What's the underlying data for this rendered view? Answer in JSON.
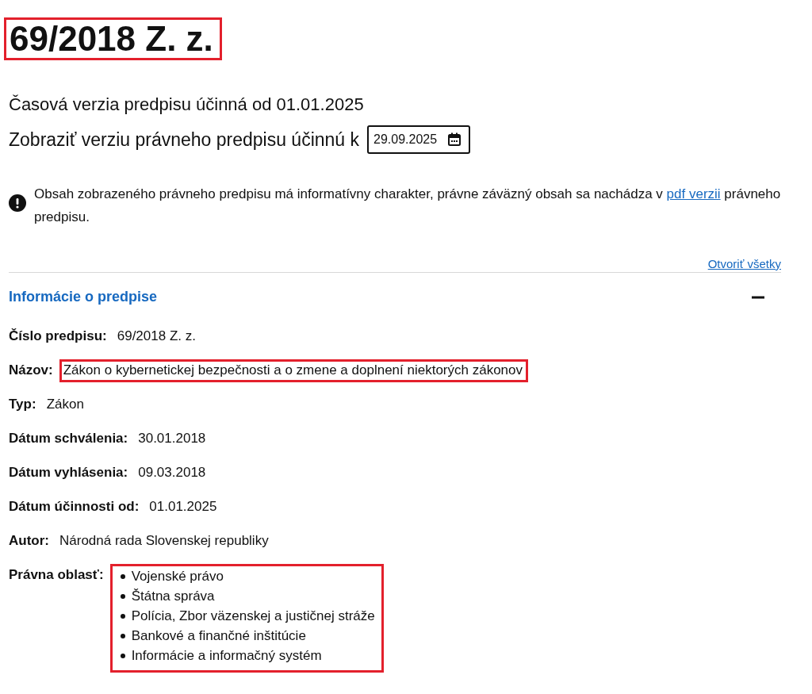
{
  "title": {
    "text": "69/2018 Z. z.",
    "highlighted": true
  },
  "version_text": "Časová verzia predpisu účinná od 01.01.2025",
  "date_picker": {
    "label": "Zobraziť verziu právneho predpisu účinnú k",
    "value": "29.09.2025"
  },
  "notice": {
    "text": "Obsah zobrazeného právneho predpisu má informatívny charakter, právne záväzný obsah sa nachádza v",
    "link": "pdf verzii",
    "text_after": "právneho predpisu."
  },
  "open_all_link": "Otvoriť všetky",
  "section": {
    "title": "Informácie o predpise",
    "expanded": true,
    "fields": [
      {
        "label": "Číslo predpisu:",
        "value": "69/2018 Z. z.",
        "highlighted": false
      },
      {
        "label": "Názov:",
        "value": "Zákon o kybernetickej bezpečnosti a o zmene a doplnení niektorých zákonov",
        "highlighted": true
      },
      {
        "label": "Typ:",
        "value": "Zákon",
        "highlighted": false
      },
      {
        "label": "Dátum schválenia:",
        "value": "30.01.2018",
        "highlighted": false
      },
      {
        "label": "Dátum vyhlásenia:",
        "value": "09.03.2018",
        "highlighted": false
      },
      {
        "label": "Dátum účinnosti od:",
        "value": "01.01.2025",
        "highlighted": false
      },
      {
        "label": "Autor:",
        "value": "Národná rada Slovenskej republiky",
        "highlighted": false
      },
      {
        "label": "Právna oblasť:",
        "values": [
          "Vojenské právo",
          "Štátna správa",
          "Polícia, Zbor väzenskej a justičnej stráže",
          "Bankové a finančné inštitúcie",
          "Informácie a informačný systém"
        ],
        "highlighted": true
      }
    ]
  }
}
